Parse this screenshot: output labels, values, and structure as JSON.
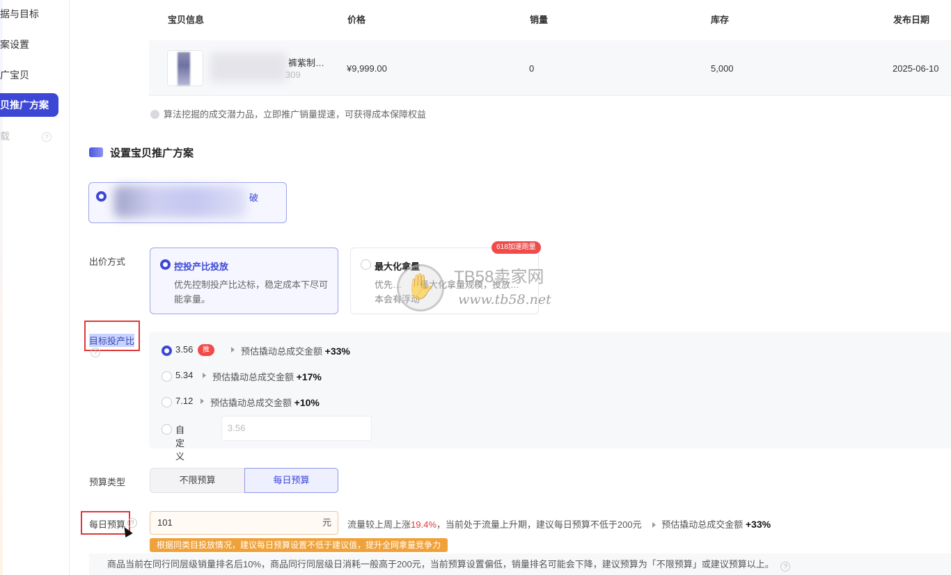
{
  "sidebar": {
    "items": [
      {
        "label": "据与目标"
      },
      {
        "label": "案设置"
      },
      {
        "label": "广宝贝"
      },
      {
        "label": "贝推广方案"
      },
      {
        "label": "载"
      }
    ]
  },
  "table": {
    "headers": [
      "宝贝信息",
      "价格",
      "销量",
      "库存",
      "发布日期"
    ],
    "row": {
      "name": "裤紫制…",
      "id": "309",
      "price": "¥9,999.00",
      "sales": "0",
      "stock": "5,000",
      "date": "2025-06-10"
    }
  },
  "tip": "算法挖掘的成交潜力品，立即推广销量提速，可获得成本保障权益",
  "section_title": "设置宝贝推广方案",
  "plan_card": {
    "label": "破"
  },
  "bid": {
    "label": "出价方式",
    "options": [
      {
        "title": "控投产比投放",
        "desc": "优先控制投产比达标，稳定成本下尽可能拿量。"
      },
      {
        "title": "最大化拿量",
        "desc": "优先…　　最大化拿量规模，投放…　本会有浮动"
      }
    ],
    "badge": "618加速跑量"
  },
  "watermark": {
    "name": "TB58卖家网",
    "url": "www.tb58.net"
  },
  "roi": {
    "label": "目标投产比",
    "options": [
      {
        "value": "3.56",
        "tag": "推荐",
        "est_label": "预估撬动总成交金额",
        "est_value": "+33%"
      },
      {
        "value": "5.34",
        "est_label": "预估撬动总成交金额",
        "est_value": "+17%"
      },
      {
        "value": "7.12",
        "est_label": "预估撬动总成交金额",
        "est_value": "+10%"
      }
    ],
    "custom_label": "自定义",
    "custom_placeholder": "3.56"
  },
  "budget_type": {
    "label": "预算类型",
    "options": [
      "不限预算",
      "每日预算"
    ],
    "selected": "每日预算"
  },
  "daily_budget": {
    "label": "每日预算",
    "value": "101",
    "unit": "元",
    "msg_prefix": "流量较上周上涨",
    "msg_up": "19.4%",
    "msg_mid": "，当前处于流量上升期，建议每日预算不低于200元",
    "est_label": "预估撬动总成交金额",
    "est_value": "+33%",
    "warning": "根据同类目投放情况，建议每日预算设置不低于建议值，提升全网拿量竞争力"
  },
  "notice": "商品当前在同行同层级销量排名后10%，商品同行同层级日消耗一般高于200元，当前预算设置偏低，销量排名可能会下降，建议预算为「不限预算」或建议预算以上。",
  "colors": {
    "accent": "#3c47d6",
    "warn": "#f0a23a",
    "red": "#e03535"
  }
}
